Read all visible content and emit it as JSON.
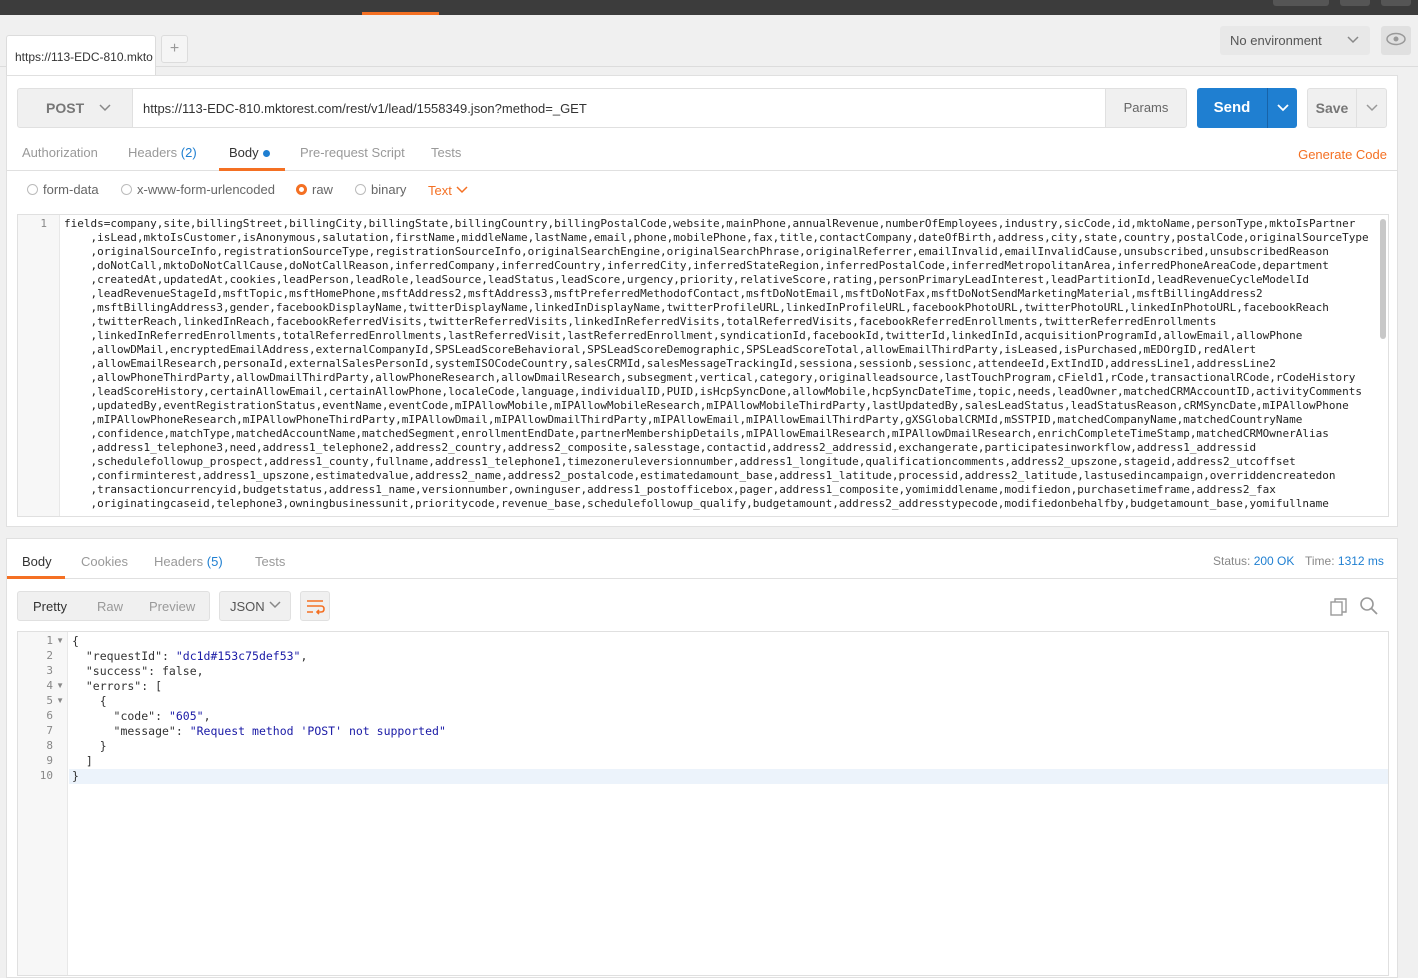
{
  "tabs": {
    "request_tab_label": "https://113-EDC-810.mkto",
    "add_tab_label": "+"
  },
  "environment": {
    "selected": "No environment"
  },
  "request": {
    "method": "POST",
    "url": "https://113-EDC-810.mktorest.com/rest/v1/lead/1558349.json?method=_GET",
    "params_label": "Params",
    "send_label": "Send",
    "save_label": "Save"
  },
  "request_tabs": {
    "authorization": "Authorization",
    "headers": "Headers",
    "headers_count": "(2)",
    "body": "Body",
    "prerequest": "Pre-request Script",
    "tests": "Tests",
    "generate_code": "Generate Code"
  },
  "body_modes": {
    "form_data": "form-data",
    "urlencoded": "x-www-form-urlencoded",
    "raw": "raw",
    "binary": "binary",
    "raw_type": "Text"
  },
  "body_editor": {
    "line_number": "1",
    "lines": [
      "fields=company,site,billingStreet,billingCity,billingState,billingCountry,billingPostalCode,website,mainPhone,annualRevenue,numberOfEmployees,industry,sicCode,id,mktoName,personType,mktoIsPartner",
      "    ,isLead,mktoIsCustomer,isAnonymous,salutation,firstName,middleName,lastName,email,phone,mobilePhone,fax,title,contactCompany,dateOfBirth,address,city,state,country,postalCode,originalSourceType",
      "    ,originalSourceInfo,registrationSourceType,registrationSourceInfo,originalSearchEngine,originalSearchPhrase,originalReferrer,emailInvalid,emailInvalidCause,unsubscribed,unsubscribedReason",
      "    ,doNotCall,mktoDoNotCallCause,doNotCallReason,inferredCompany,inferredCountry,inferredCity,inferredStateRegion,inferredPostalCode,inferredMetropolitanArea,inferredPhoneAreaCode,department",
      "    ,createdAt,updatedAt,cookies,leadPerson,leadRole,leadSource,leadStatus,leadScore,urgency,priority,relativeScore,rating,personPrimaryLeadInterest,leadPartitionId,leadRevenueCycleModelId",
      "    ,leadRevenueStageId,msftTopic,msftHomePhone,msftAddress2,msftAddress3,msftPreferredMethodofContact,msftDoNotEmail,msftDoNotFax,msftDoNotSendMarketingMaterial,msftBillingAddress2",
      "    ,msftBillingAddress3,gender,facebookDisplayName,twitterDisplayName,linkedInDisplayName,twitterProfileURL,linkedInProfileURL,facebookPhotoURL,twitterPhotoURL,linkedInPhotoURL,facebookReach",
      "    ,twitterReach,linkedInReach,facebookReferredVisits,twitterReferredVisits,linkedInReferredVisits,totalReferredVisits,facebookReferredEnrollments,twitterReferredEnrollments",
      "    ,linkedInReferredEnrollments,totalReferredEnrollments,lastReferredVisit,lastReferredEnrollment,syndicationId,facebookId,twitterId,linkedInId,acquisitionProgramId,allowEmail,allowPhone",
      "    ,allowDMail,encryptedEmailAddress,externalCompanyId,SPSLeadScoreBehavioral,SPSLeadScoreDemographic,SPSLeadScoreTotal,allowEmailThirdParty,isLeased,isPurchased,mEDOrgID,redAlert",
      "    ,allowEmailResearch,personaId,externalSalesPersonId,systemISOCodeCountry,salesCRMId,salesMessageTrackingId,sessiona,sessionb,sessionc,attendeeId,ExtIndID,addressLine1,addressLine2",
      "    ,allowPhoneThirdParty,allowDmailThirdParty,allowPhoneResearch,allowDmailResearch,subsegment,vertical,category,originalleadsource,lastTouchProgram,cField1,rCode,transactionalRCode,rCodeHistory",
      "    ,leadScoreHistory,certainAllowEmail,certainAllowPhone,localeCode,language,individualID,PUID,isHcpSyncDone,allowMobile,hcpSyncDateTime,topic,needs,leadOwner,matchedCRMAccountID,activityComments",
      "    ,updatedBy,eventRegistrationStatus,eventName,eventCode,mIPAllowMobile,mIPAllowMobileResearch,mIPAllowMobileThirdParty,lastUpdatedBy,salesLeadStatus,leadStatusReason,cRMSyncDate,mIPAllowPhone",
      "    ,mIPAllowPhoneResearch,mIPAllowPhoneThirdParty,mIPAllowDmail,mIPAllowDmailThirdParty,mIPAllowEmail,mIPAllowEmailThirdParty,gXSGlobalCRMId,mSSTPID,matchedCompanyName,matchedCountryName",
      "    ,confidence,matchType,matchedAccountName,matchedSegment,enrollmentEndDate,partnerMembershipDetails,mIPAllowEmailResearch,mIPAllowDmailResearch,enrichCompleteTimeStamp,matchedCRMOwnerAlias",
      "    ,address1_telephone3,need,address1_telephone2,address2_country,address2_composite,salesstage,contactid,address2_addressid,exchangerate,participatesinworkflow,address1_addressid",
      "    ,schedulefollowup_prospect,address1_county,fullname,address1_telephone1,timezoneruleversionnumber,address1_longitude,qualificationcomments,address2_upszone,stageid,address2_utcoffset",
      "    ,confirminterest,address1_upszone,estimatedvalue,address2_name,address2_postalcode,estimatedamount_base,address1_latitude,processid,address2_latitude,lastusedincampaign,overriddencreatedon",
      "    ,transactioncurrencyid,budgetstatus,address1_name,versionnumber,owninguser,address1_postofficebox,pager,address1_composite,yomimiddlename,modifiedon,purchasetimeframe,address2_fax",
      "    ,originatingcaseid,telephone3,owningbusinessunit,prioritycode,revenue_base,schedulefollowup_qualify,budgetamount,address2_addresstypecode,modifiedonbehalfby,budgetamount_base,yomifullname"
    ]
  },
  "response_tabs": {
    "body": "Body",
    "cookies": "Cookies",
    "headers": "Headers",
    "headers_count": "(5)",
    "tests": "Tests"
  },
  "status": {
    "status_label": "Status:",
    "status_value": "200 OK",
    "time_label": "Time:",
    "time_value": "1312 ms"
  },
  "format": {
    "pretty": "Pretty",
    "raw": "Raw",
    "preview": "Preview",
    "type": "JSON"
  },
  "response_body": {
    "line_numbers": [
      "1",
      "2",
      "3",
      "4",
      "5",
      "6",
      "7",
      "8",
      "9",
      "10"
    ],
    "l1": "{",
    "l2_key": "  \"requestId\": ",
    "l2_val": "\"dc1d#153c75def53\"",
    "l2_end": ",",
    "l3": "  \"success\": false,",
    "l4": "  \"errors\": [",
    "l5": "    {",
    "l6_key": "      \"code\": ",
    "l6_val": "\"605\"",
    "l6_end": ",",
    "l7_key": "      \"message\": ",
    "l7_val": "\"Request method 'POST' not supported\"",
    "l8": "    }",
    "l9": "  ]",
    "l10": "}"
  }
}
